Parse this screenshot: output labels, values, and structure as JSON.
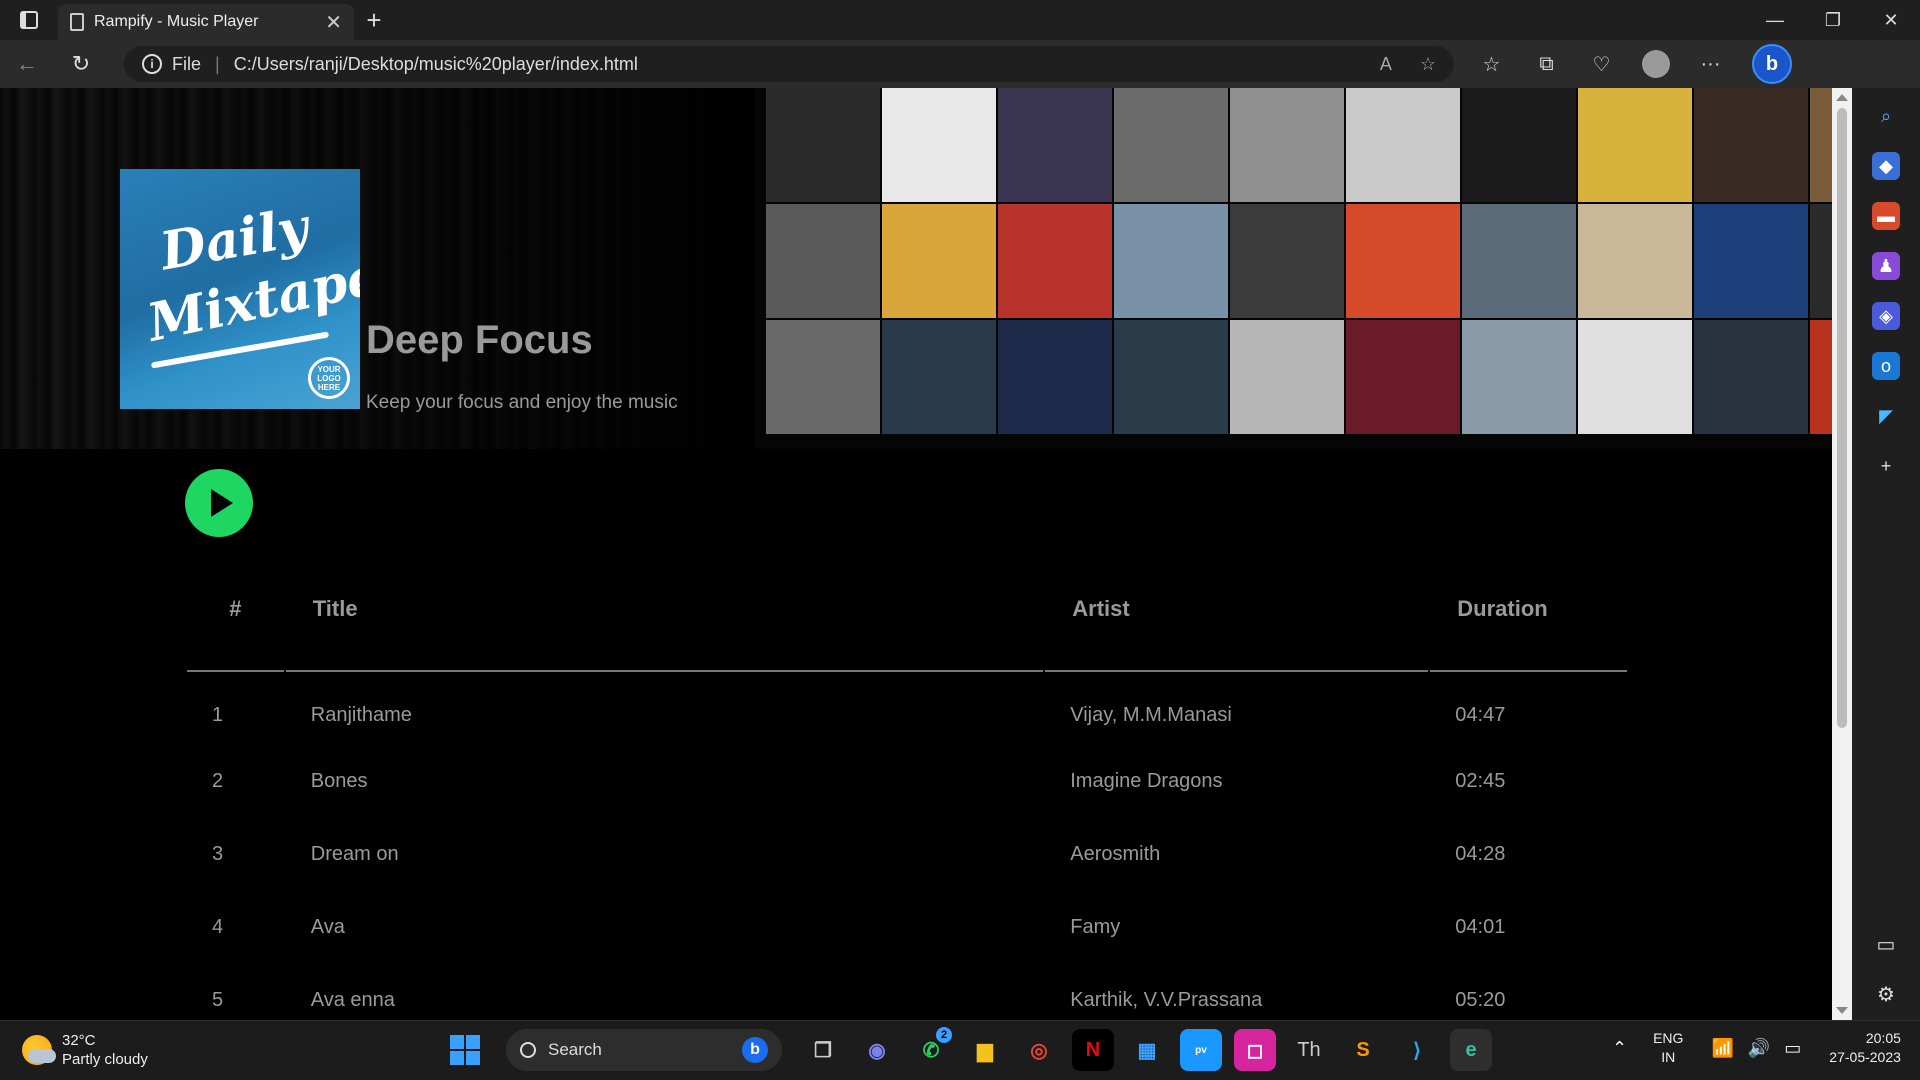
{
  "browser": {
    "tab_title": "Rampify - Music Player",
    "new_tab_symbol": "+",
    "address_scheme": "File",
    "address_url": "C:/Users/ranji/Desktop/music%20player/index.html"
  },
  "playlist": {
    "cover_text_line1": "Daily",
    "cover_text_line2": "Mixtape",
    "cover_logo_text": "YOUR LOGO HERE",
    "title": "Deep Focus",
    "subtitle": "Keep your focus and enjoy the music"
  },
  "table": {
    "headers": {
      "num": "#",
      "title": "Title",
      "artist": "Artist",
      "duration": "Duration"
    },
    "rows": [
      {
        "num": "1",
        "title": "Ranjithame",
        "artist": "Vijay, M.M.Manasi",
        "duration": "04:47"
      },
      {
        "num": "2",
        "title": "Bones",
        "artist": "Imagine Dragons",
        "duration": "02:45"
      },
      {
        "num": "3",
        "title": "Dream on",
        "artist": "Aerosmith",
        "duration": "04:28"
      },
      {
        "num": "4",
        "title": "Ava",
        "artist": "Famy",
        "duration": "04:01"
      },
      {
        "num": "5",
        "title": "Ava enna",
        "artist": "Karthik, V.V.Prassana",
        "duration": "05:20"
      }
    ]
  },
  "colors": {
    "accent_green": "#1ed760",
    "text_gray": "#9a9a9a",
    "collage": [
      "#2a2a2a",
      "#e8e8e8",
      "#3a3550",
      "#6b6b6b",
      "#8f8f8f",
      "#c9c9c9",
      "#1a1a1a",
      "#d9b23e",
      "#3a2a24",
      "#7a5b3a",
      "#5a5a5a",
      "#d8a63a",
      "#b8332b",
      "#7a92a8",
      "#3b3b3b",
      "#d44a2a",
      "#5a6a78",
      "#c9b89a",
      "#1c3f7a",
      "#2a2a2a",
      "#6a6a6a",
      "#2b3a4a",
      "#1e2a4a",
      "#2a3b4a",
      "#b7b7b7",
      "#6b1a2a",
      "#8a9aa8",
      "#e0e0e0",
      "#2a3440",
      "#b8331f"
    ]
  },
  "taskbar": {
    "weather_temp": "32°C",
    "weather_desc": "Partly cloudy",
    "search_label": "Search",
    "whatsapp_badge": "2",
    "lang_line1": "ENG",
    "lang_line2": "IN",
    "time": "20:05",
    "date": "27-05-2023"
  }
}
